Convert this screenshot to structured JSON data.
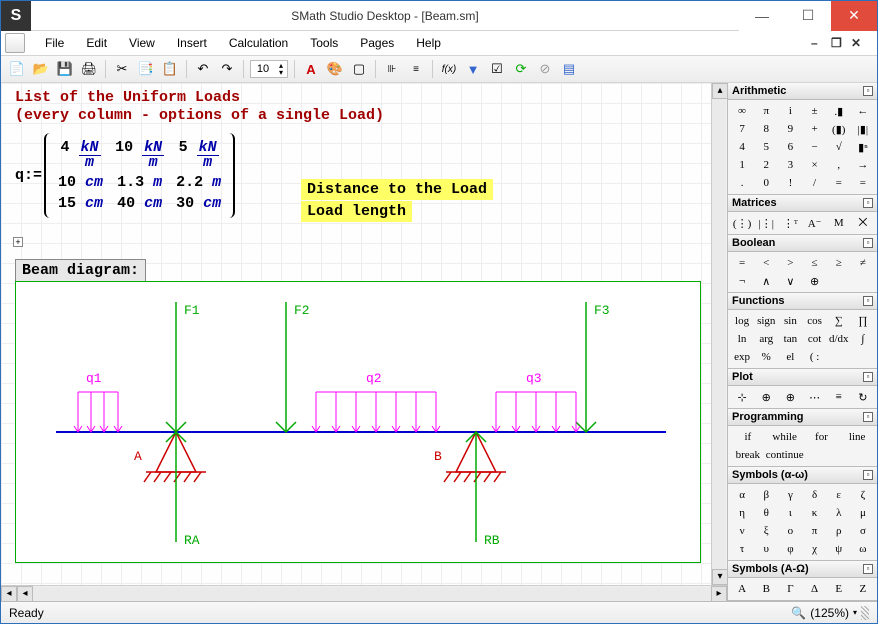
{
  "window": {
    "title": "SMath Studio Desktop - [Beam.sm]",
    "app_initial": "S"
  },
  "menu": [
    "File",
    "Edit",
    "View",
    "Insert",
    "Calculation",
    "Tools",
    "Pages",
    "Help"
  ],
  "toolbar": {
    "font_size": "10"
  },
  "doc": {
    "title1": "List of the Uniform Loads",
    "title2": "(every column - options of a single Load)",
    "q_label": "q:=",
    "matrix": {
      "row1": [
        {
          "v": "4",
          "unit": "kN",
          "den": "m"
        },
        {
          "v": "10",
          "unit": "kN",
          "den": "m"
        },
        {
          "v": "5",
          "unit": "kN",
          "den": "m"
        }
      ],
      "row2": [
        {
          "v": "10",
          "unit": "cm"
        },
        {
          "v": "1.3",
          "unit": "m"
        },
        {
          "v": "2.2",
          "unit": "m"
        }
      ],
      "row3": [
        {
          "v": "15",
          "unit": "cm"
        },
        {
          "v": "40",
          "unit": "cm"
        },
        {
          "v": "30",
          "unit": "cm"
        }
      ]
    },
    "note1": "Distance to the Load",
    "note2": "Load length",
    "plus": "+",
    "diagram_label": "Beam diagram:",
    "diagram": {
      "F": [
        "F1",
        "F2",
        "F3"
      ],
      "q": [
        "q1",
        "q2",
        "q3"
      ],
      "supports": [
        "A",
        "B"
      ],
      "reactions": [
        "RA",
        "RB"
      ]
    }
  },
  "panels": {
    "arith": {
      "title": "Arithmetic",
      "cells": [
        "∞",
        "π",
        "i",
        "±",
        ".▮",
        "←",
        "7",
        "8",
        "9",
        "+",
        "(▮)",
        "|▮|",
        "4",
        "5",
        "6",
        "−",
        "√",
        "▮ⁿ",
        "1",
        "2",
        "3",
        "×",
        ",",
        "→",
        ".",
        "0",
        "!",
        "/",
        "=",
        "="
      ]
    },
    "matrices": {
      "title": "Matrices",
      "cells": [
        "(⋮)",
        "|⋮|",
        "⋮ᵀ",
        "A⁻",
        "M",
        "⨉"
      ]
    },
    "boolean": {
      "title": "Boolean",
      "cells": [
        "=",
        "<",
        ">",
        "≤",
        "≥",
        "≠",
        "¬",
        "∧",
        "∨",
        "⊕"
      ]
    },
    "functions": {
      "title": "Functions",
      "cells": [
        "log",
        "sign",
        "sin",
        "cos",
        "∑",
        "∏",
        "ln",
        "arg",
        "tan",
        "cot",
        "d/dx",
        "∫",
        "exp",
        "%",
        "el",
        "( :"
      ]
    },
    "plot": {
      "title": "Plot",
      "cells": [
        "⊹",
        "⊕",
        "⊕",
        "⋯",
        "≡",
        "↻"
      ]
    },
    "programming": {
      "title": "Programming",
      "cells": [
        "if",
        "while",
        "for",
        "line",
        "break",
        "continue"
      ]
    },
    "symbols_lower": {
      "title": "Symbols (α-ω)",
      "cells": [
        "α",
        "β",
        "γ",
        "δ",
        "ε",
        "ζ",
        "η",
        "θ",
        "ι",
        "κ",
        "λ",
        "μ",
        "ν",
        "ξ",
        "ο",
        "π",
        "ρ",
        "σ",
        "τ",
        "υ",
        "φ",
        "χ",
        "ψ",
        "ω"
      ]
    },
    "symbols_upper": {
      "title": "Symbols (Α-Ω)",
      "cells": [
        "Α",
        "Β",
        "Γ",
        "Δ",
        "Ε",
        "Ζ"
      ]
    }
  },
  "status": {
    "text": "Ready",
    "zoom": "(125%)"
  }
}
